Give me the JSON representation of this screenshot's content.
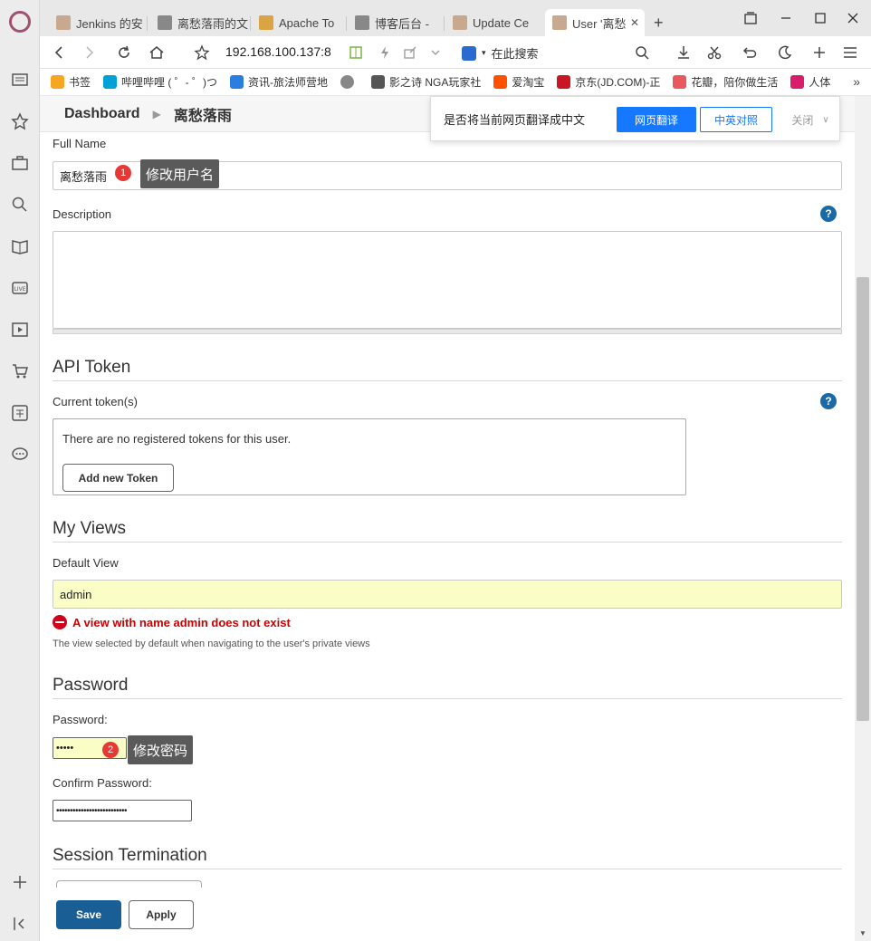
{
  "browser": {
    "tabs": [
      {
        "label": "Jenkins 的安"
      },
      {
        "label": "离愁落雨的文"
      },
      {
        "label": "Apache To"
      },
      {
        "label": "博客后台 - "
      },
      {
        "label": "Update Ce"
      },
      {
        "label": "User '离愁"
      }
    ],
    "new_tab_label": "+",
    "url": "192.168.100.137:8",
    "search_placeholder": "在此搜索"
  },
  "bookmarks": [
    {
      "label": "书签",
      "color": "#f5a623"
    },
    {
      "label": "哔哩哔哩 ( ゜- ゜)つ",
      "color": "#00a1d6"
    },
    {
      "label": "资讯-旅法师营地",
      "color": "#2a7de1"
    },
    {
      "label": "",
      "color": "#888888"
    },
    {
      "label": "影之诗 NGA玩家社",
      "color": "#555555"
    },
    {
      "label": "爱淘宝",
      "color": "#ff5000"
    },
    {
      "label": "京东(JD.COM)-正",
      "color": "#c81623"
    },
    {
      "label": "花瓣，陪你做生活",
      "color": "#e8585f"
    },
    {
      "label": "人体",
      "color": "#d81e6a"
    }
  ],
  "bookmarks_more": "»",
  "breadcrumb": {
    "root": "Dashboard",
    "current": "离愁落雨"
  },
  "translate": {
    "prompt": "是否将当前网页翻译成中文",
    "primary": "网页翻译",
    "secondary": "中英对照",
    "close": "关闭"
  },
  "form": {
    "full_name_label": "Full Name",
    "full_name_value": "离愁落雨",
    "description_label": "Description",
    "help_glyph": "?",
    "api_token_heading": "API Token",
    "current_tokens_label": "Current token(s)",
    "no_tokens_text": "There are no registered tokens for this user.",
    "add_token_label": "Add new Token",
    "my_views_heading": "My Views",
    "default_view_label": "Default View",
    "default_view_value": "admin",
    "default_view_error": "A view with name admin does not exist",
    "default_view_hint": "The view selected by default when navigating to the user's private views",
    "password_heading": "Password",
    "password_label": "Password:",
    "password_value": "•••••",
    "confirm_password_label": "Confirm Password:",
    "confirm_password_value": "••••••••••••••••••••••••••",
    "session_heading": "Session Termination",
    "save_label": "Save",
    "apply_label": "Apply"
  },
  "annotations": [
    {
      "number": "1",
      "text": "修改用户名"
    },
    {
      "number": "2",
      "text": "修改密码"
    }
  ],
  "colors": {
    "primary_button": "#1a5e96",
    "help_icon": "#1a6aa5",
    "error": "#cc0000",
    "marker": "#e53935",
    "translate_blue": "#1677ff"
  }
}
